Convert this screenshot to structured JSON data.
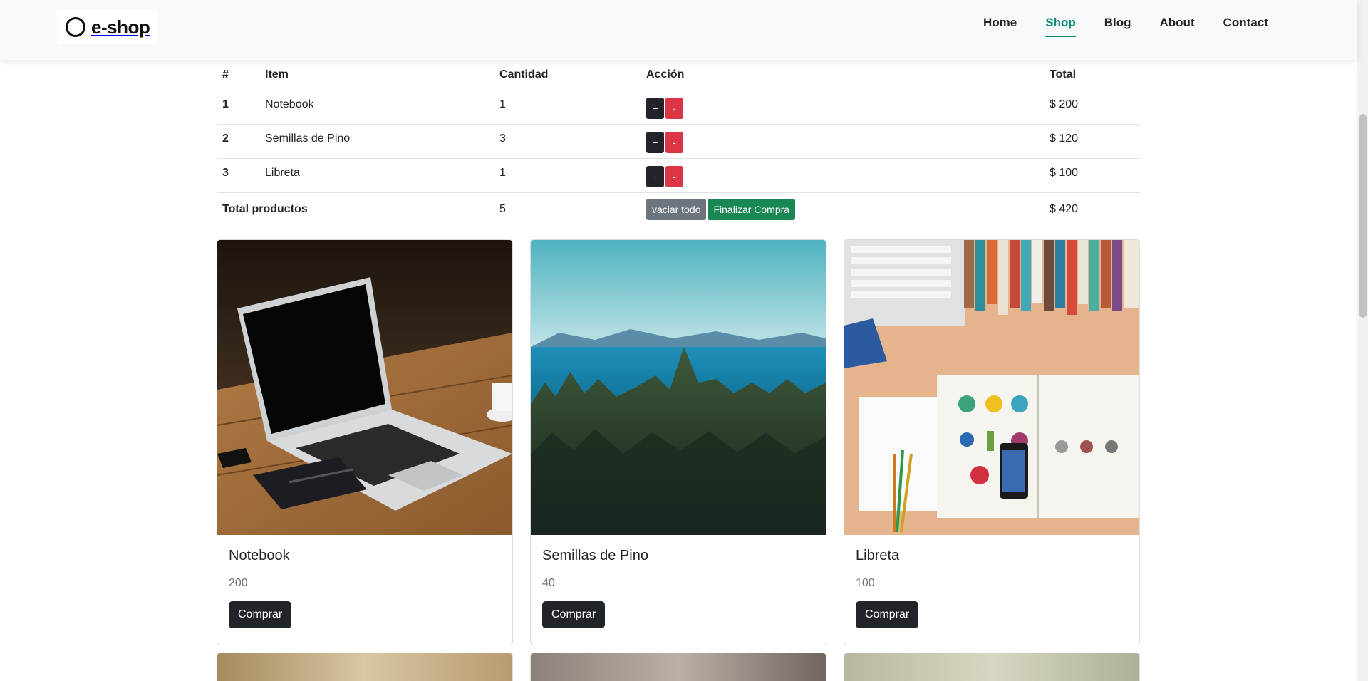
{
  "brand": {
    "name": "e-shop",
    "icon": "ring-logo-icon"
  },
  "nav": {
    "items": [
      {
        "label": "Home",
        "active": false
      },
      {
        "label": "Shop",
        "active": true
      },
      {
        "label": "Blog",
        "active": false
      },
      {
        "label": "About",
        "active": false
      },
      {
        "label": "Contact",
        "active": false
      }
    ],
    "active_color": "#0d8a7b"
  },
  "cart": {
    "headers": {
      "index": "#",
      "item": "Item",
      "quantity": "Cantidad",
      "action": "Acción",
      "total": "Total"
    },
    "rows": [
      {
        "index": "1",
        "item": "Notebook",
        "quantity": "1",
        "total": "$ 200"
      },
      {
        "index": "2",
        "item": "Semillas de Pino",
        "quantity": "3",
        "total": "$ 120"
      },
      {
        "index": "3",
        "item": "Libreta",
        "quantity": "1",
        "total": "$ 100"
      }
    ],
    "plus_label": "+",
    "minus_label": "-",
    "footer": {
      "label": "Total productos",
      "quantity": "5",
      "clear_label": "vaciar todo",
      "checkout_label": "Finalizar Compra",
      "total": "$ 420"
    }
  },
  "products": [
    {
      "title": "Notebook",
      "price": "200",
      "button": "Comprar",
      "image": "laptop-on-wooden-table"
    },
    {
      "title": "Semillas de Pino",
      "price": "40",
      "button": "Comprar",
      "image": "pine-forest-by-the-sea"
    },
    {
      "title": "Libreta",
      "price": "100",
      "button": "Comprar",
      "image": "desk-with-notebooks-and-books"
    }
  ],
  "colors": {
    "dark": "#212529",
    "danger": "#dc3545",
    "secondary": "#6c757d",
    "success": "#198754"
  }
}
